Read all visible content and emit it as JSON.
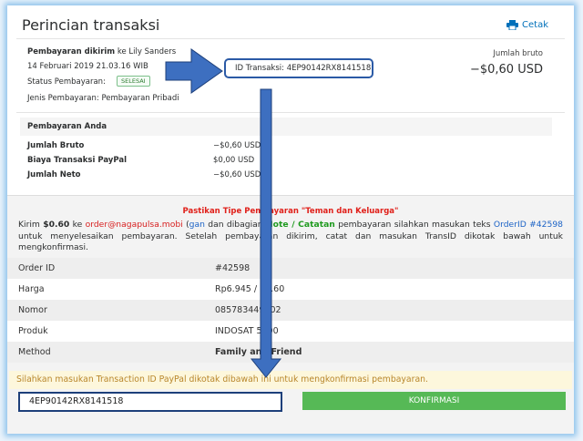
{
  "header": {
    "title": "Perincian transaksi",
    "print_label": "Cetak"
  },
  "transaction": {
    "sent_label": "Pembayaran dikirim",
    "sent_to": "ke Lily Sanders",
    "datetime": "14 Februari 2019 21.03.16 WIB",
    "status_label": "Status Pembayaran:",
    "status_value": "SELESAI",
    "type_line": "Jenis Pembayaran: Pembayaran Pribadi",
    "id_line": "ID Transaksi: 4EP90142RX8141518",
    "gross_label": "Jumlah bruto",
    "gross_value": "−$0,60 USD"
  },
  "payment": {
    "section_title": "Pembayaran Anda",
    "rows": [
      {
        "label": "Jumlah Bruto",
        "value": "−$0,60 USD"
      },
      {
        "label": "Biaya Transaksi PayPal",
        "value": "$0,00 USD"
      },
      {
        "label": "Jumlah Neto",
        "value": "−$0,60 USD"
      }
    ]
  },
  "instructions": {
    "warning": "Pastikan Tipe Pembayaran \"Teman dan Keluarga\"",
    "p1": "Kirim",
    "amount": "$0.60",
    "p2": "ke",
    "email": "order@nagapulsa.mobi",
    "p3": "(",
    "p3b": "gan",
    "p4": "dan dibagian",
    "note": "Note / Catatan",
    "p5": "pembayaran silahkan masukan teks",
    "order_ref": "OrderID #42598",
    "p6": "untuk menyelesaikan pembayaran. Setelah pembayaran dikirim, catat dan masukan TransID dikotak bawah untuk mengkonfirmasi."
  },
  "order": {
    "rows": [
      {
        "label": "Order ID",
        "value": "#42598"
      },
      {
        "label": "Harga",
        "value": "Rp6.945 / $0.60"
      },
      {
        "label": "Nomor",
        "value": "085783449502"
      },
      {
        "label": "Produk",
        "value": "INDOSAT 5000"
      },
      {
        "label": "Method",
        "value": "Family and Friend"
      }
    ]
  },
  "confirm": {
    "notice": "Silahkan masukan Transaction ID PayPal dikotak dibawah ini untuk mengkonfirmasi pembayaran.",
    "input_value": "4EP90142RX8141518",
    "button_label": "KONFIRMASI"
  },
  "colors": {
    "accent": "#0070ba",
    "arrow": "#3d6fc0",
    "confirm_button": "#56b956",
    "warning": "#e0201a"
  }
}
